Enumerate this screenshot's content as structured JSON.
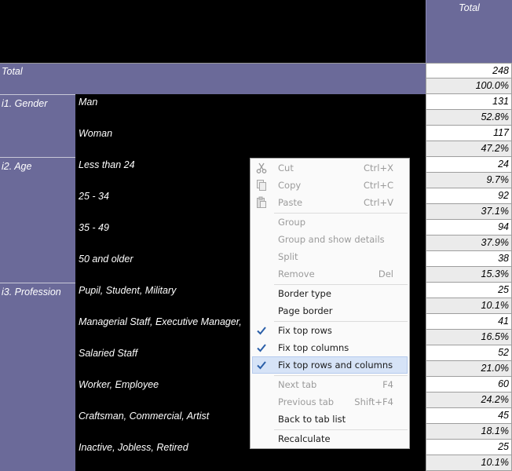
{
  "header": {
    "total_label": "Total"
  },
  "total_row": {
    "label": "Total"
  },
  "groups": [
    {
      "label": "i1. Gender",
      "rows": [
        "Man",
        "Woman"
      ]
    },
    {
      "label": "i2. Age",
      "rows": [
        "Less than 24",
        "25 - 34",
        "35 - 49",
        "50 and older"
      ]
    },
    {
      "label": "i3. Profession",
      "rows": [
        "Pupil, Student, Military",
        "Managerial Staff, Executive Manager,",
        "Salaried Staff",
        "Worker, Employee",
        "Craftsman, Commercial, Artist",
        "Inactive, Jobless, Retired"
      ]
    }
  ],
  "values": [
    [
      "248",
      "100.0%"
    ],
    [
      "131",
      "52.8%"
    ],
    [
      "117",
      "47.2%"
    ],
    [
      "24",
      "9.7%"
    ],
    [
      "92",
      "37.1%"
    ],
    [
      "94",
      "37.9%"
    ],
    [
      "38",
      "15.3%"
    ],
    [
      "25",
      "10.1%"
    ],
    [
      "41",
      "16.5%"
    ],
    [
      "52",
      "21.0%"
    ],
    [
      "60",
      "24.2%"
    ],
    [
      "45",
      "18.1%"
    ],
    [
      "25",
      "10.1%"
    ]
  ],
  "menu": {
    "cut": {
      "label": "Cut",
      "shortcut": "Ctrl+X",
      "icon": "scissors-icon",
      "enabled": false
    },
    "copy": {
      "label": "Copy",
      "shortcut": "Ctrl+C",
      "icon": "copy-icon",
      "enabled": false
    },
    "paste": {
      "label": "Paste",
      "shortcut": "Ctrl+V",
      "icon": "paste-icon",
      "enabled": false
    },
    "group": {
      "label": "Group",
      "enabled": false
    },
    "group_details": {
      "label": "Group and show details",
      "enabled": false
    },
    "split": {
      "label": "Split",
      "enabled": false
    },
    "remove": {
      "label": "Remove",
      "shortcut": "Del",
      "enabled": false
    },
    "border_type": {
      "label": "Border type",
      "enabled": true
    },
    "page_border": {
      "label": "Page border",
      "enabled": true
    },
    "fix_rows": {
      "label": "Fix top rows",
      "checked": true
    },
    "fix_columns": {
      "label": "Fix top columns",
      "checked": true
    },
    "fix_rows_columns": {
      "label": "Fix top rows and columns",
      "checked": true,
      "highlighted": true
    },
    "next_tab": {
      "label": "Next tab",
      "shortcut": "F4",
      "enabled": false
    },
    "prev_tab": {
      "label": "Previous tab",
      "shortcut": "Shift+F4",
      "enabled": false
    },
    "back_list": {
      "label": "Back to tab list",
      "enabled": true
    },
    "recalculate": {
      "label": "Recalculate",
      "enabled": true
    }
  },
  "colors": {
    "header_purple": "#6b6a99",
    "background": "#000000",
    "menu_highlight": "#d6e3f7"
  }
}
